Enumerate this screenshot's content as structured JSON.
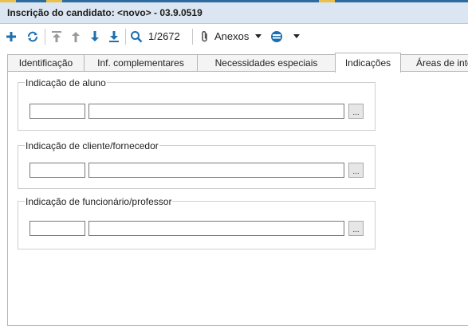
{
  "window": {
    "title": "Inscrição do candidato: <novo> - 03.9.0519"
  },
  "toolbar": {
    "icons": [
      "plus-icon",
      "refresh-icon",
      "first-record-icon",
      "previous-record-icon",
      "next-record-icon",
      "last-record-icon",
      "search-icon",
      "paperclip-icon",
      "chevron-down-icon",
      "layers-icon",
      "chevron-down-icon"
    ],
    "record_counter": "1/2672",
    "attachments_label": "Anexos",
    "accent_color": "#1e6fae"
  },
  "tabs": [
    {
      "label": "Identificação",
      "active": false
    },
    {
      "label": "Inf. complementares",
      "active": false
    },
    {
      "label": "Necessidades especiais",
      "active": false
    },
    {
      "label": "Indicações",
      "active": true
    },
    {
      "label": "Áreas de inte",
      "active": false
    }
  ],
  "groups": [
    {
      "legend": "Indicação de aluno",
      "code_value": "",
      "name_value": "",
      "button_label": "..."
    },
    {
      "legend": "Indicação de cliente/fornecedor",
      "code_value": "",
      "name_value": "",
      "button_label": "..."
    },
    {
      "legend": "Indicação de funcionário/professor",
      "code_value": "",
      "name_value": "",
      "button_label": "..."
    }
  ]
}
